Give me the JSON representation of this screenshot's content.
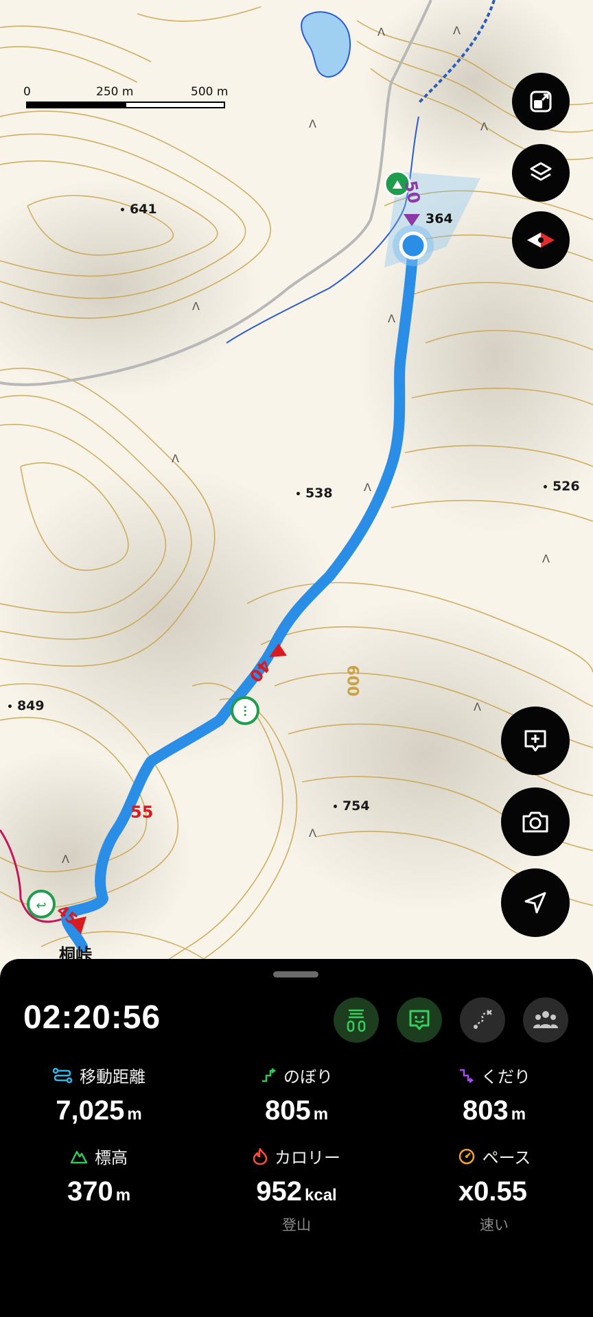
{
  "map": {
    "scale": {
      "labels": [
        "0",
        "250 m",
        "500 m"
      ]
    },
    "spot_heights": [
      "641",
      "538",
      "526",
      "849",
      "754",
      "364"
    ],
    "contour_label": "600",
    "route_markers": [
      "50",
      "40",
      "55",
      "45"
    ],
    "place_label": "桐峠",
    "colors": {
      "route": "#2a8ee6",
      "contour": "#c9a24a",
      "marker": "#d81b23"
    }
  },
  "buttons": {
    "resize": "resize-icon",
    "layers": "layers-icon",
    "compass": "compass-icon",
    "add_memo": "add-memo-icon",
    "camera": "camera-icon",
    "locate": "navigation-arrow-icon"
  },
  "panel": {
    "timer": "02:20:56",
    "action_buttons": [
      "guidepost-icon",
      "chat-face-icon",
      "route-icon",
      "group-icon"
    ],
    "stats": [
      {
        "label": "移動距離",
        "value": "7,025",
        "unit": "m",
        "icon_color": "#35b6e8"
      },
      {
        "label": "のぼり",
        "value": "805",
        "unit": "m",
        "icon_color": "#2ecb5a"
      },
      {
        "label": "くだり",
        "value": "803",
        "unit": "m",
        "icon_color": "#a44ef0"
      },
      {
        "label": "標高",
        "value": "370",
        "unit": "m",
        "icon_color": "#2ecb5a"
      },
      {
        "label": "カロリー",
        "value": "952",
        "unit": "kcal",
        "sub": "登山",
        "icon_color": "#ff4d3d"
      },
      {
        "label": "ペース",
        "value": "x0.55",
        "unit": "",
        "sub": "速い",
        "icon_color": "#f2a52a"
      }
    ]
  }
}
